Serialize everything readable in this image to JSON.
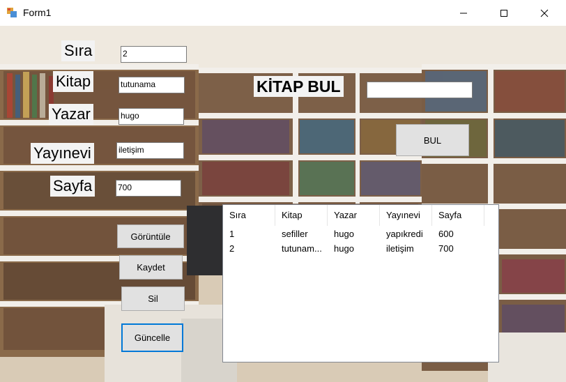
{
  "window": {
    "title": "Form1",
    "icon": "windows-form-icon"
  },
  "labels": {
    "sira": "Sıra",
    "kitap": "Kitap",
    "yazar": "Yazar",
    "yayinevi": "Yayınevi",
    "sayfa": "Sayfa"
  },
  "fields": {
    "sira": "2",
    "kitap": "tutunama",
    "yazar": "hugo",
    "yayinevi": "iletişim",
    "sayfa": "700"
  },
  "search": {
    "heading": "KİTAP BUL",
    "value": "",
    "button": "BUL"
  },
  "buttons": {
    "goruntule": "Görüntüle",
    "kaydet": "Kaydet",
    "sil": "Sil",
    "guncelle": "Güncelle"
  },
  "listview": {
    "columns": [
      "Sıra",
      "Kitap",
      "Yazar",
      "Yayınevi",
      "Sayfa"
    ],
    "rows": [
      [
        "1",
        "sefiller",
        "hugo",
        "yapıkredi",
        "600"
      ],
      [
        "2",
        "tutunam...",
        "hugo",
        "iletişim",
        "700"
      ]
    ]
  },
  "colors": {
    "focus_border": "#0078d7",
    "button_bg": "#e1e1e1"
  }
}
